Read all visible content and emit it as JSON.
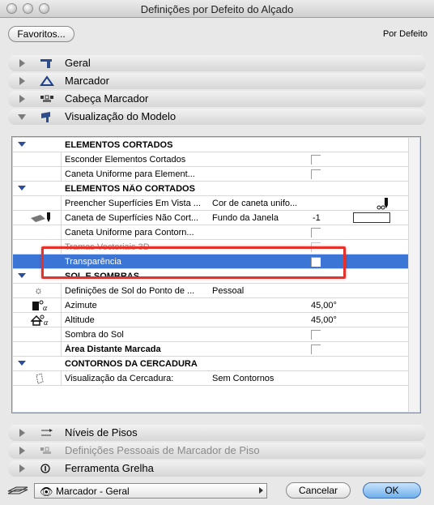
{
  "window": {
    "title": "Definições por Defeito do Alçado"
  },
  "toolbar": {
    "favorites_label": "Favoritos...",
    "defaults_label": "Por Defeito"
  },
  "sections_top": [
    {
      "label": "Geral",
      "icon": "elevation-icon"
    },
    {
      "label": "Marcador",
      "icon": "marker-triangle-icon"
    },
    {
      "label": "Cabeça Marcador",
      "icon": "marker-head-icon"
    },
    {
      "label": "Visualização do Modelo",
      "icon": "model-display-icon"
    }
  ],
  "properties": {
    "groups": {
      "cut": "ELEMENTOS CORTADOS",
      "uncut": "ELEMENTOS NÃO CORTADOS",
      "sun": "SOL E SOMBRAS",
      "boundary": "CONTORNOS DA CERCADURA"
    },
    "rows": {
      "hide_cut": "Esconder Elementos Cortados",
      "uniform_pen_cut": "Caneta Uniforme para Element...",
      "fill_surfaces": "Preencher Superfícies Em Vista ...",
      "fill_surfaces_val": "Cor de caneta unifo...",
      "uncut_pen": "Caneta de Superfícies Não Cort...",
      "uncut_pen_val": "Fundo da Janela",
      "uncut_pen_num": "-1",
      "uniform_contour": "Caneta Uniforme para Contorn...",
      "vector_hatch": "Tramas Vectoriais 3D",
      "transparency": "Transparência",
      "sun_settings": "Definições de Sol do Ponto de ...",
      "sun_settings_val": "Pessoal",
      "azimuth": "Azimute",
      "azimuth_val": "45,00°",
      "altitude": "Altitude",
      "altitude_val": "45,00°",
      "sun_shadow": "Sombra do Sol",
      "marked_distant": "Área Distante Marcada",
      "boundary_display": "Visualização da Cercadura:",
      "boundary_display_val": "Sem Contornos"
    }
  },
  "sections_bottom": [
    {
      "label": "Níveis de Pisos",
      "icon": "story-levels-icon"
    },
    {
      "label": "Definições Pessoais de Marcador de Piso",
      "icon": "story-marker-icon"
    },
    {
      "label": "Ferramenta Grelha",
      "icon": "grid-tool-icon"
    }
  ],
  "footer": {
    "layer_value": "Marcador - Geral",
    "cancel_label": "Cancelar",
    "ok_label": "OK"
  },
  "colors": {
    "selection": "#3b75d6",
    "highlight_box": "#e4322b",
    "ok_button": "#6fb0ec"
  }
}
